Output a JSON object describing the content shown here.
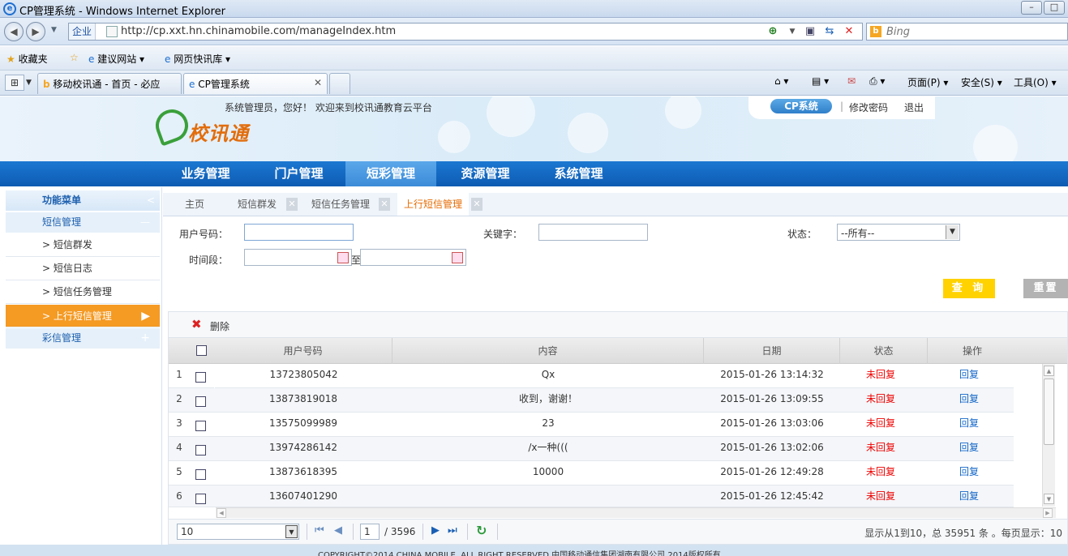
{
  "window": {
    "title": "CP管理系统 - Windows Internet Explorer"
  },
  "address_bar": {
    "zone": "企业",
    "url": "http://cp.xxt.hn.chinamobile.com/manageIndex.htm",
    "search_placeholder": "Bing"
  },
  "favorites_bar": {
    "favorites": "收藏夹",
    "suggested_sites": "建议网站",
    "web_slices": "网页快讯库"
  },
  "browser_tabs": [
    {
      "label": "移动校讯通 - 首页 - 必应"
    },
    {
      "label": "CP管理系统"
    }
  ],
  "command_bar": {
    "page": "页面(P)",
    "safety": "安全(S)",
    "tools": "工具(O)"
  },
  "header": {
    "logo_text": "校讯通",
    "welcome": "系统管理员，您好！ 欢迎来到校讯通教育云平台",
    "system_button": "CP系统",
    "separator": "|",
    "change_password": "修改密码",
    "logout": "退出"
  },
  "main_nav": [
    {
      "label": "业务管理"
    },
    {
      "label": "门户管理"
    },
    {
      "label": "短彩管理"
    },
    {
      "label": "资源管理"
    },
    {
      "label": "系统管理"
    }
  ],
  "sidebar": {
    "title": "功能菜单",
    "collapse": "<",
    "sms_group": "短信管理",
    "sms_group_toggle": "—",
    "items": [
      {
        "label": "> 短信群发"
      },
      {
        "label": "> 短信日志"
      },
      {
        "label": "> 短信任务管理"
      },
      {
        "label": "> 上行短信管理"
      }
    ],
    "mms_group": "彩信管理",
    "mms_group_toggle": "+"
  },
  "content_tabs": [
    {
      "label": "主页"
    },
    {
      "label": "短信群发"
    },
    {
      "label": "短信任务管理"
    },
    {
      "label": "上行短信管理"
    }
  ],
  "form": {
    "user_number_label": "用户号码：",
    "keyword_label": "关键字：",
    "status_label": "状态：",
    "status_value": "--所有--",
    "period_label": "时间段：",
    "to_label": "至",
    "query_button": "查 询",
    "reset_button": "重置"
  },
  "grid": {
    "delete_label": "删除",
    "columns": [
      "用户号码",
      "内容",
      "日期",
      "状态",
      "操作"
    ],
    "rows": [
      {
        "n": "1",
        "number": "13723805042",
        "content": "Qx",
        "date": "2015-01-26 13:14:32",
        "status": "未回复",
        "action": "回复"
      },
      {
        "n": "2",
        "number": "13873819018",
        "content": "收到，谢谢！",
        "date": "2015-01-26 13:09:55",
        "status": "未回复",
        "action": "回复"
      },
      {
        "n": "3",
        "number": "13575099989",
        "content": "23",
        "date": "2015-01-26 13:03:06",
        "status": "未回复",
        "action": "回复"
      },
      {
        "n": "4",
        "number": "13974286142",
        "content": "/x一种(((",
        "date": "2015-01-26 13:02:06",
        "status": "未回复",
        "action": "回复"
      },
      {
        "n": "5",
        "number": "13873618395",
        "content": "10000",
        "date": "2015-01-26 12:49:28",
        "status": "未回复",
        "action": "回复"
      },
      {
        "n": "6",
        "number": "13607401290",
        "content": "",
        "date": "2015-01-26 12:45:42",
        "status": "未回复",
        "action": "回复"
      }
    ]
  },
  "pager": {
    "page_size": "10",
    "current_page": "1",
    "total_pages": "/ 3596",
    "summary": "显示从1到10，总 35951 条 。每页显示：10"
  },
  "footer": {
    "text": "COPYRIGHT©2014 CHINA MOBILE. ALL RIGHT RESERVED 中国移动通信集团湖南有限公司 2014版权所有"
  },
  "colors": {
    "nav_blue": "#0d5bb3",
    "selected_orange": "#f59a23",
    "query_yellow": "#ffd200",
    "status_red": "#e00000",
    "link_blue": "#1467c8"
  }
}
